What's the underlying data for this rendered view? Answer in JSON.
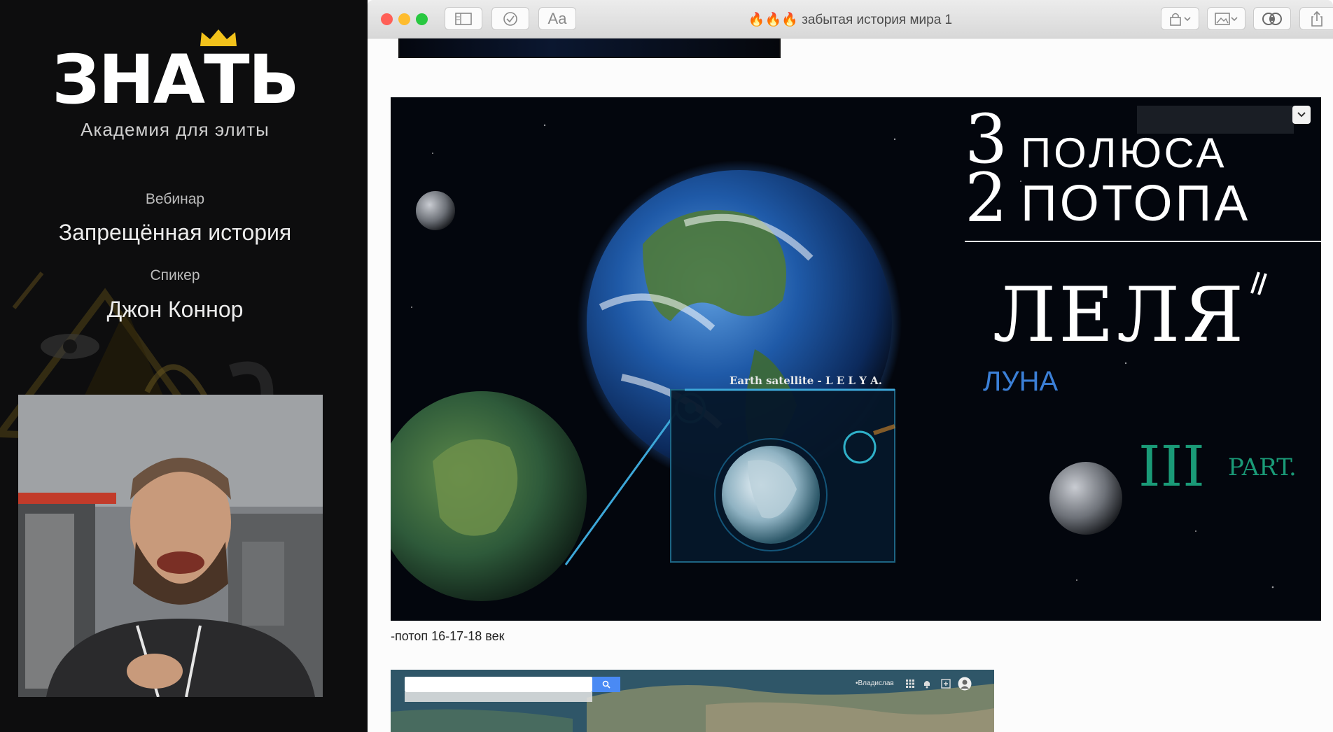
{
  "sidebar": {
    "logo": "ЗНАТЬ",
    "tagline": "Академия для элиты",
    "webinar_label": "Вебинар",
    "webinar_title": "Запрещённая история",
    "speaker_label": "Спикер",
    "speaker_name": "Джон Коннор"
  },
  "window": {
    "title": "🔥🔥🔥 забытая история мира 1",
    "font_button": "Aa"
  },
  "slide": {
    "numeral_top": "3",
    "numeral_bottom": "2",
    "line1": "ПОЛЮСА",
    "line2": "ПОТОПА",
    "big_title": "ЛЕЛЯ",
    "accent_mark": "//",
    "subtitle": "ЛУНА",
    "part_num": "III",
    "part_label": "PART.",
    "satellite_label": "Earth satellite - L E L Y A."
  },
  "caption": "-потоп 16-17-18 век",
  "map_toolbar": {
    "location_text": "•Владислав"
  },
  "colors": {
    "accent_gold": "#f2c21b",
    "slide_teal": "#1a9a77",
    "slide_blue": "#3b7fd6",
    "close": "#ff5f57",
    "minimize": "#febc2e",
    "maximize": "#28c840"
  },
  "icons": [
    "crown-icon",
    "sidebar-icon",
    "checkmark-icon",
    "lock-icon",
    "image-icon",
    "reader-icon",
    "share-icon",
    "dropdown-icon",
    "search-icon",
    "apps-icon",
    "bell-icon",
    "user-icon"
  ]
}
